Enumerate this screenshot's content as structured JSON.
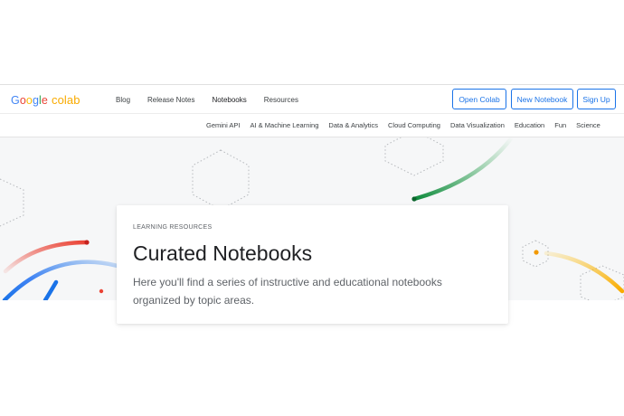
{
  "brand": {
    "google": "Google",
    "product": "colab"
  },
  "nav": {
    "links": [
      "Blog",
      "Release Notes",
      "Notebooks",
      "Resources"
    ],
    "active": "Notebooks"
  },
  "actions": {
    "open_colab": "Open Colab",
    "new_notebook": "New Notebook",
    "sign_up": "Sign Up"
  },
  "subnav": {
    "items": [
      "Gemini API",
      "AI & Machine Learning",
      "Data & Analytics",
      "Cloud Computing",
      "Data Visualization",
      "Education",
      "Fun",
      "Science"
    ]
  },
  "hero_card": {
    "eyebrow": "LEARNING RESOURCES",
    "title": "Curated Notebooks",
    "description": "Here you'll find a series of instructive and educational notebooks organized by topic areas."
  },
  "colors": {
    "accent_blue": "#1a73e8",
    "colab_orange": "#f9ab00",
    "hero_bg": "#f6f7f8"
  }
}
